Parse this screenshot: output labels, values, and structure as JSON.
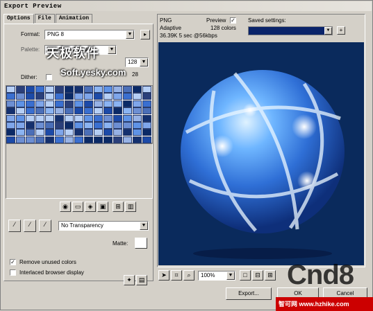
{
  "window": {
    "title": "Export Preview"
  },
  "tabs": [
    {
      "label": "Options",
      "active": true
    },
    {
      "label": "File",
      "active": false
    },
    {
      "label": "Animation",
      "active": false
    }
  ],
  "options": {
    "format_label": "Format:",
    "format_value": "PNG 8",
    "palette_label": "Palette:",
    "palette_value": "WebSnap Adaptive",
    "colors_value": "128",
    "dither_label": "Dither:",
    "dither_pct": "28",
    "transparency_value": "No Transparency",
    "matte_label": "Matte:",
    "remove_unused_label": "Remove unused colors",
    "remove_unused_checked": true,
    "interlaced_label": "Interlaced browser display",
    "interlaced_checked": false
  },
  "watermark": {
    "top": "天极软件",
    "url": "Soft.yesky.com"
  },
  "preview": {
    "format": "PNG",
    "palette": "Adaptive",
    "size_time": "36.39K  5 sec @56kbps",
    "preview_label": "Preview",
    "preview_checked": true,
    "colors": "128 colors",
    "saved_settings_label": "Saved settings:"
  },
  "bottombar": {
    "zoom_value": "100%",
    "export_label": "Export...",
    "ok_label": "OK",
    "cancel_label": "Cancel"
  },
  "overlay": {
    "brand": "Cnd8",
    "footer": "智可网 www.hzhike.com"
  },
  "colors": {
    "window_bg": "#d4d0c8",
    "preview_bg": "#0a2a5c",
    "selection": "#0a246a"
  }
}
